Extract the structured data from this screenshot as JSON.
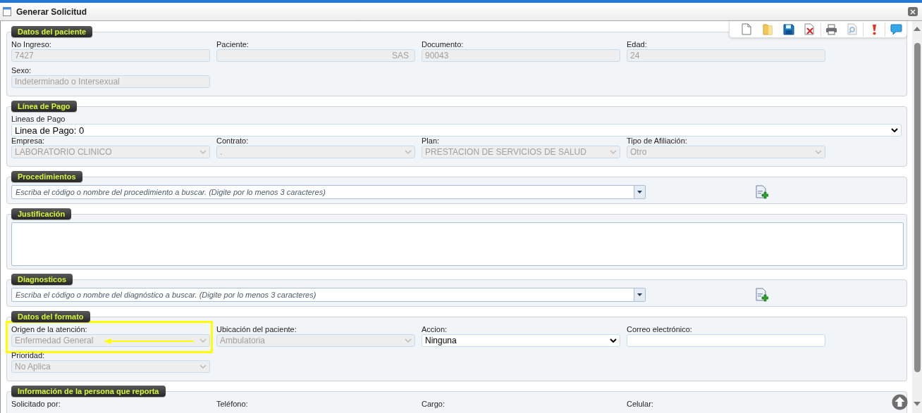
{
  "window": {
    "title": "Generar Solicitud"
  },
  "toolbar": [
    {
      "kind": "new"
    },
    {
      "kind": "open"
    },
    {
      "kind": "save"
    },
    {
      "kind": "delete"
    },
    {
      "kind": "separator"
    },
    {
      "kind": "print"
    },
    {
      "kind": "preview"
    },
    {
      "kind": "separator"
    },
    {
      "kind": "alert"
    },
    {
      "kind": "separator"
    },
    {
      "kind": "comment"
    }
  ],
  "sections": [
    {
      "title": "Datos del paciente",
      "fields": [
        {
          "kind": "text",
          "label": "No Ingreso:",
          "value": "7427",
          "disabled": true
        },
        {
          "kind": "text_right",
          "label": "Paciente:",
          "value": "SAS",
          "disabled": true
        },
        {
          "kind": "text",
          "label": "Documento:",
          "value": "90043",
          "disabled": true
        },
        {
          "kind": "text",
          "label": "Edad:",
          "value": "24",
          "disabled": true
        },
        {
          "kind": "text",
          "label": "Sexo:",
          "value": "Indeterminado o Intersexual",
          "disabled": true
        }
      ]
    },
    {
      "title": "Línea de Pago",
      "fields": [
        {
          "kind": "wide_select",
          "label": "Lineas de Pago",
          "value": "Linea de Pago: 0",
          "disabled": false
        },
        {
          "kind": "select",
          "label": "Empresa:",
          "value": "LABORATORIO CLINICO",
          "disabled": true
        },
        {
          "kind": "select",
          "label": "Contrato:",
          "value": ".",
          "disabled": true
        },
        {
          "kind": "select",
          "label": "Plan:",
          "value": "PRESTACION DE SERVICIOS DE SALUD",
          "disabled": true
        },
        {
          "kind": "select",
          "label": "Tipo de Afiliación:",
          "value": "Otro",
          "disabled": true
        }
      ]
    },
    {
      "title": "Procedimientos",
      "fields": [
        {
          "kind": "search",
          "placeholder": "Escriba el código o nombre del procedimiento a buscar. (Digite por lo menos 3 caracteres)"
        }
      ]
    },
    {
      "title": "Justificación",
      "fields": [
        {
          "kind": "textarea"
        }
      ]
    },
    {
      "title": "Diagnosticos",
      "fields": [
        {
          "kind": "search",
          "placeholder": "Escriba el código o nombre del diagnóstico a buscar. (Digite por lo menos 3 caracteres)"
        }
      ]
    },
    {
      "title": "Datos del formato",
      "fields": [
        {
          "kind": "select",
          "label": "Origen de la atención:",
          "value": "Enfermedad General",
          "disabled": true,
          "highlighted": true
        },
        {
          "kind": "select",
          "label": "Ubicación del paciente:",
          "value": "Ambulatoria",
          "disabled": true,
          "highlighted": false
        },
        {
          "kind": "select",
          "label": "Accion:",
          "value": "Ninguna",
          "disabled": false,
          "highlighted": false
        },
        {
          "kind": "text",
          "label": "Correo electrónico:",
          "disabled": false,
          "highlighted": false
        },
        {
          "kind": "select",
          "label": "Prioridad:",
          "value": "No Aplica",
          "disabled": true,
          "highlighted": false
        }
      ]
    },
    {
      "title": "Información de la persona que reporta",
      "fields": [
        {
          "kind": "label",
          "label": "Solicitado por:"
        },
        {
          "kind": "label",
          "label": "Teléfono:"
        },
        {
          "kind": "label",
          "label": "Cargo:"
        },
        {
          "kind": "label",
          "label": "Celular:"
        }
      ]
    }
  ]
}
